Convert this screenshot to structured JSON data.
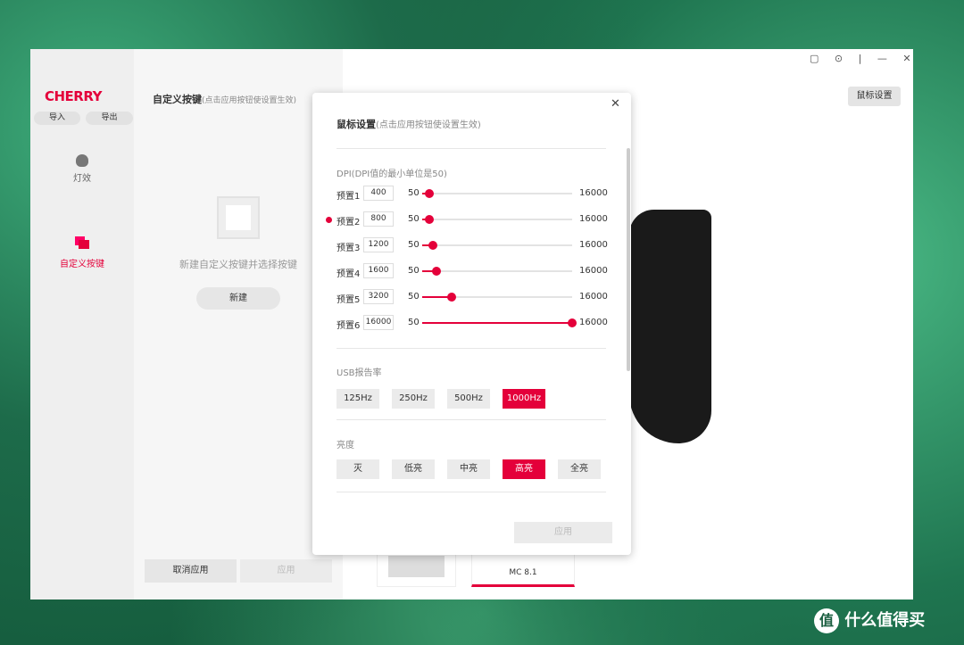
{
  "brand": "CHERRY",
  "sidebar": {
    "import": "导入",
    "export": "导出",
    "items": [
      {
        "label": "灯效",
        "icon": "bulb-icon",
        "active": false
      },
      {
        "label": "自定义按键",
        "icon": "layers-icon",
        "active": true
      }
    ]
  },
  "custom_panel": {
    "title": "自定义按键",
    "hint": "(点击应用按钮使设置生效)",
    "empty_text": "新建自定义按键并选择按键",
    "new_button": "新建",
    "cancel_button": "取消应用",
    "apply_button": "应用"
  },
  "titlebar": {
    "icons": [
      "feedback-icon",
      "settings-icon",
      "minimize-icon",
      "close-icon"
    ]
  },
  "mouse_settings_button": "鼠标设置",
  "devices": [
    {
      "name": "",
      "type": "keyboard",
      "active": false
    },
    {
      "name": "MC 8.1",
      "type": "mouse",
      "active": true
    }
  ],
  "modal": {
    "title": "鼠标设置",
    "hint": "(点击应用按钮使设置生效)",
    "dpi_label": "DPI(DPI值的最小单位是50)",
    "dpi_min": "50",
    "dpi_max": "16000",
    "active_preset": 2,
    "presets": [
      {
        "label": "预置1",
        "value": "400"
      },
      {
        "label": "预置2",
        "value": "800"
      },
      {
        "label": "预置3",
        "value": "1200"
      },
      {
        "label": "预置4",
        "value": "1600"
      },
      {
        "label": "预置5",
        "value": "3200"
      },
      {
        "label": "预置6",
        "value": "16000"
      }
    ],
    "usb_label": "USB报告率",
    "usb_options": [
      "125Hz",
      "250Hz",
      "500Hz",
      "1000Hz"
    ],
    "usb_selected": "1000Hz",
    "brightness_label": "亮度",
    "brightness_options": [
      "灭",
      "低亮",
      "中亮",
      "高亮",
      "全亮"
    ],
    "brightness_selected": "高亮",
    "apply_button": "应用"
  },
  "watermark": "什么值得买",
  "accent": "#e4003a"
}
